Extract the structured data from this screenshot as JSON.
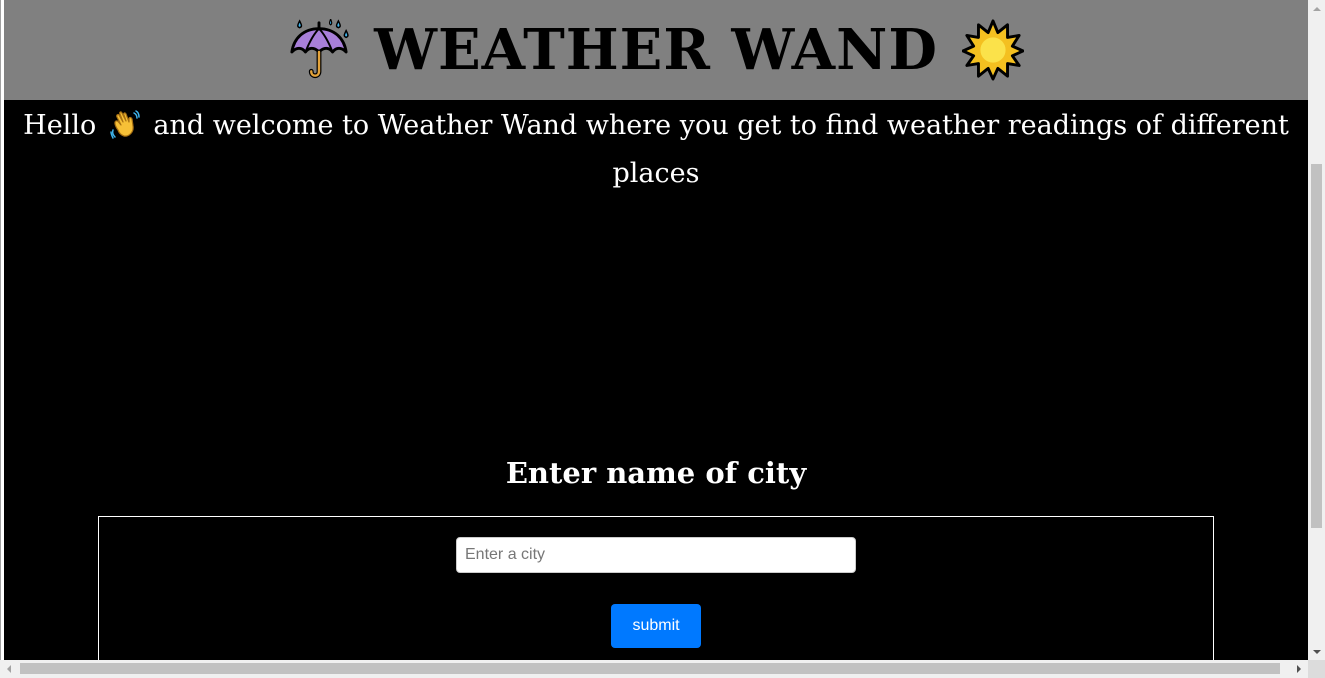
{
  "header": {
    "title": "WEATHER WAND",
    "left_icon": "umbrella-with-rain-icon",
    "right_icon": "sun-icon",
    "background": "#808080"
  },
  "intro": {
    "before_icon": "Hello",
    "icon": "waving-hand-icon",
    "after_icon": "and welcome to Weather Wand where you get to find weather readings of different places"
  },
  "form": {
    "heading": "Enter name of city",
    "city_placeholder": "Enter a city",
    "city_value": "",
    "submit_label": "submit",
    "submit_color": "#0079ff"
  },
  "page": {
    "background": "#000000",
    "text_color": "#ffffff"
  }
}
